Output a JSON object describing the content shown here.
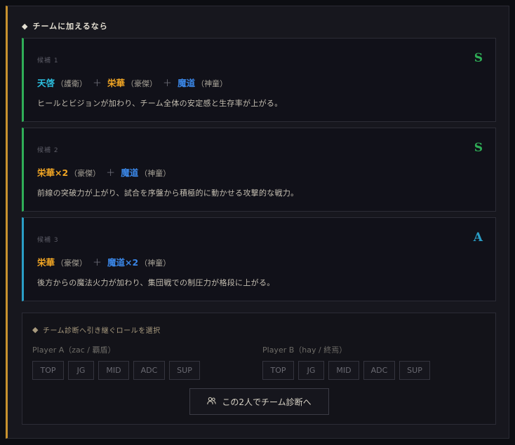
{
  "section": {
    "title": "チームに加えるなら"
  },
  "colors": {
    "gold": "#f0a524",
    "blue": "#3a86e6",
    "teal": "#2cc0e0",
    "green": "#2fae57",
    "grade_a": "#2a9ec6"
  },
  "candidates": [
    {
      "label": "候補 1",
      "grade": "S",
      "members": [
        {
          "name": "天啓",
          "role": "（護衛）"
        },
        {
          "name": "栄華",
          "role": "（豪傑）"
        },
        {
          "name": "魔道",
          "role": "（神童）"
        }
      ],
      "plus": "＋",
      "description": "ヒールとビジョンが加わり、チーム全体の安定感と生存率が上がる。"
    },
    {
      "label": "候補 2",
      "grade": "S",
      "members": [
        {
          "name": "栄華×2",
          "role": "（豪傑）"
        },
        {
          "name": "魔道",
          "role": "（神童）"
        }
      ],
      "plus": "＋",
      "description": "前線の突破力が上がり、試合を序盤から積極的に動かせる攻撃的な戦力。"
    },
    {
      "label": "候補 3",
      "grade": "A",
      "members": [
        {
          "name": "栄華",
          "role": "（豪傑）"
        },
        {
          "name": "魔道×2",
          "role": "（神童）"
        }
      ],
      "plus": "＋",
      "description": "後方からの魔法火力が加わり、集団戦での制圧力が格段に上がる。"
    }
  ],
  "role_select": {
    "title": "チーム診断へ引き継ぐロールを選択",
    "players": [
      {
        "label": "Player A（zac / 覇盾）",
        "roles": [
          "TOP",
          "JG",
          "MID",
          "ADC",
          "SUP"
        ]
      },
      {
        "label": "Player B（hay / 終焉）",
        "roles": [
          "TOP",
          "JG",
          "MID",
          "ADC",
          "SUP"
        ]
      }
    ],
    "button_label": "この2人でチーム診断へ",
    "button_icon": "users-icon"
  }
}
